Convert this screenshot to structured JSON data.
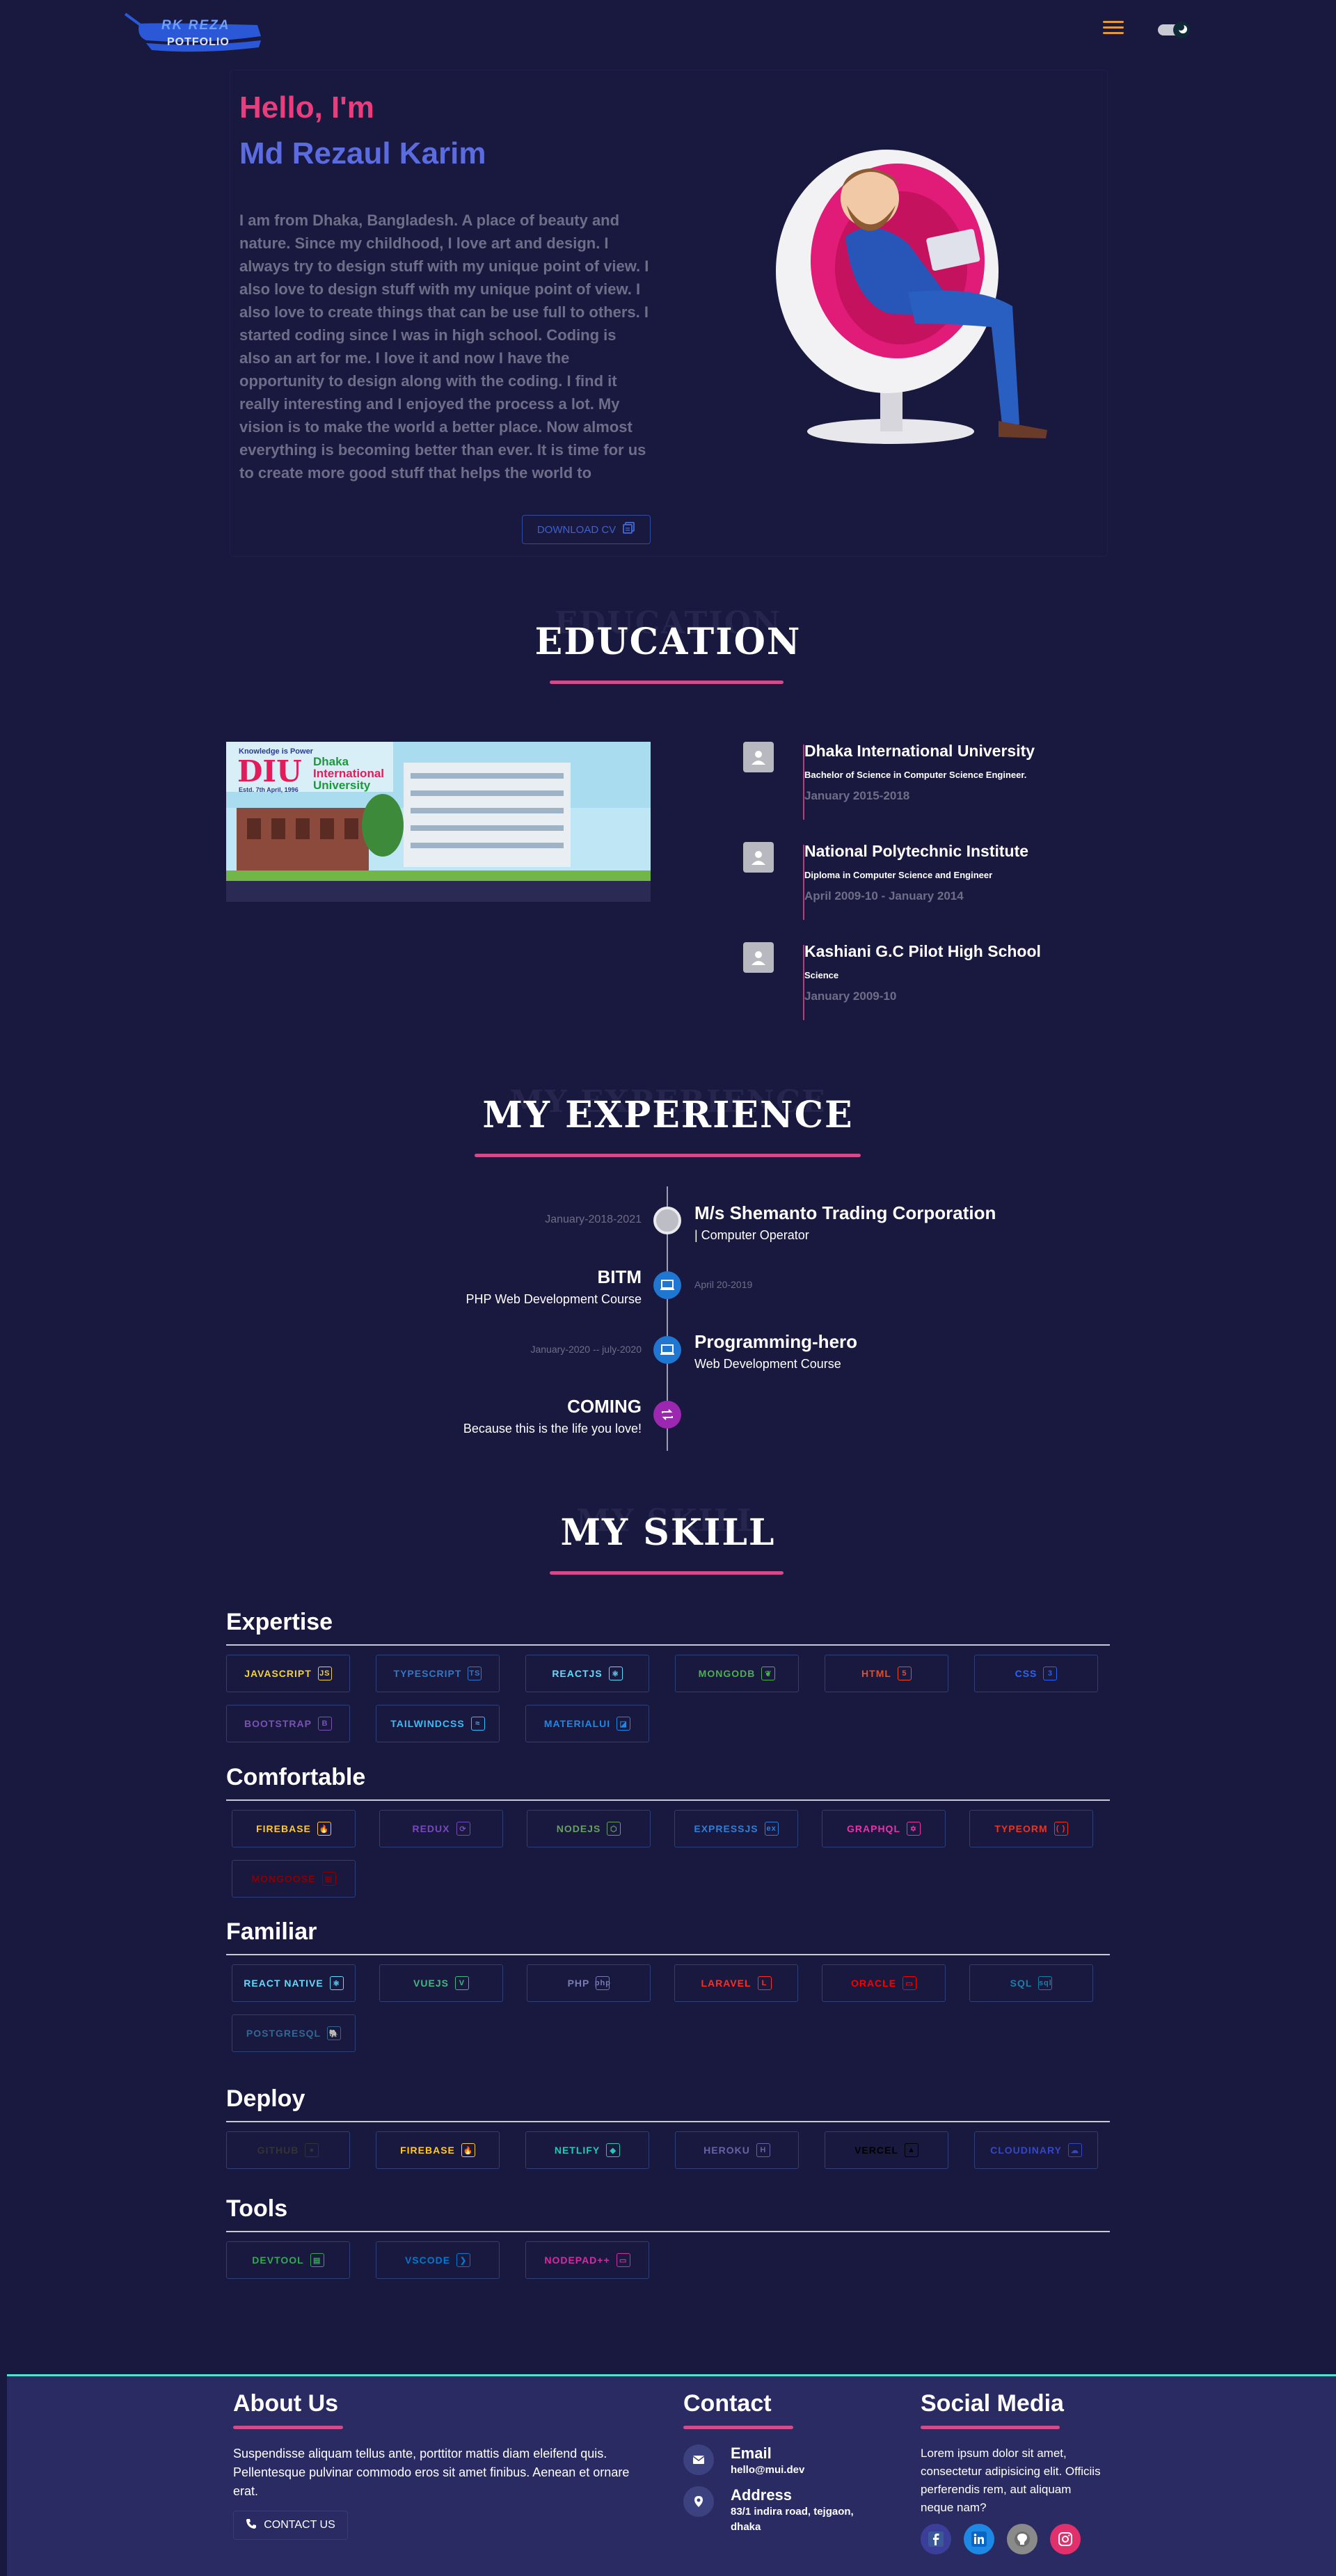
{
  "header": {
    "logo_line1": "RK REZA",
    "logo_line2": "POTFOLIO",
    "menu_icon": "hamburger-icon",
    "theme_toggle_icon": "theme-toggle-icon"
  },
  "hero": {
    "greeting": "Hello, I'm",
    "name": "Md Rezaul Karim",
    "bio": "I am from Dhaka, Bangladesh. A place of beauty and nature. Since my childhood, I love art and design. I always try to design stuff with my unique point of view. I also love to design stuff with my unique point of view. I also love to create things that can be use full to others. I started coding since I was in high school. Coding is also an art for me. I love it and now I have the opportunity to design along with the coding. I find it really interesting and I enjoyed the process a lot. My vision is to make the world a better place. Now almost everything is becoming better than ever. It is time for us to create more good stuff that helps the world to become a better place.",
    "download_label": "DOWNLOAD CV",
    "colors": {
      "greeting": "#ea3d7c",
      "name": "#5b6be0"
    }
  },
  "education": {
    "ghost": "EDUCATION",
    "title": "EDUCATION",
    "image": {
      "tagline": "Knowledge is Power",
      "abbr": "DIU",
      "est": "Estd. 7th April, 1996",
      "name_line1": "Dhaka",
      "name_line2": "International",
      "name_line3": "University"
    },
    "items": [
      {
        "name": "Dhaka International University",
        "degree": "Bachelor of Science in Computer Science Engineer.",
        "date": "January 2015-2018"
      },
      {
        "name": "National Polytechnic Institute",
        "degree": "Diploma in Computer Science and Engineer",
        "date": "April 2009-10 - January 2014"
      },
      {
        "name": "Kashiani G.C Pilot High School",
        "degree": "Science",
        "date": "January 2009-10"
      }
    ]
  },
  "experience": {
    "ghost": "MY EXPERIENCE",
    "title": "MY EXPERIENCE",
    "items": [
      {
        "side": "right",
        "title": "M/s Shemanto Trading Corporation",
        "subtitle": "| Computer Operator",
        "date": "January-2018-2021"
      },
      {
        "side": "left",
        "title": "BITM",
        "subtitle": "PHP Web Development Course",
        "date": "April 20-2019"
      },
      {
        "side": "right",
        "title": "Programming-hero",
        "subtitle": "Web Development Course",
        "date": "January-2020 -- july-2020"
      },
      {
        "side": "left",
        "title": "COMING",
        "subtitle": "Because this is the life you love!",
        "date": ""
      }
    ]
  },
  "skills": {
    "ghost": "MY SKILL",
    "title": "MY SKILL",
    "groups": [
      {
        "title": "Expertise",
        "items": [
          {
            "label": "JAVASCRIPT",
            "color": "#f0d33a",
            "icon": "JS"
          },
          {
            "label": "TYPESCRIPT",
            "color": "#3178c6",
            "icon": "TS"
          },
          {
            "label": "REACTJS",
            "color": "#61dafb",
            "icon": "⚛"
          },
          {
            "label": "MONGODB",
            "color": "#4caf50",
            "icon": "❦"
          },
          {
            "label": "HTML",
            "color": "#e44d26",
            "icon": "5"
          },
          {
            "label": "CSS",
            "color": "#2965f1",
            "icon": "3"
          },
          {
            "label": "BOOTSTRAP",
            "color": "#7952b3",
            "icon": "B"
          },
          {
            "label": "TAILWINDCSS",
            "color": "#38bdf8",
            "icon": "≈"
          },
          {
            "label": "MATERIALUI",
            "color": "#1e88e5",
            "icon": "◪"
          }
        ]
      },
      {
        "title": "Comfortable",
        "items": [
          {
            "label": "FIREBASE",
            "color": "#ffca28",
            "icon": "🔥"
          },
          {
            "label": "REDUX",
            "color": "#764abc",
            "icon": "⟳"
          },
          {
            "label": "NODEJS",
            "color": "#68a063",
            "icon": "⬡"
          },
          {
            "label": "EXPRESSJS",
            "color": "#2f7fd6",
            "icon": "ex"
          },
          {
            "label": "GRAPHQL",
            "color": "#e535ab",
            "icon": "✡"
          },
          {
            "label": "TYPEORM",
            "color": "#e83524",
            "icon": "( )"
          },
          {
            "label": "MONGOOSE",
            "color": "#880000",
            "icon": "▤"
          }
        ]
      },
      {
        "title": "Familiar",
        "items": [
          {
            "label": "REACT NATIVE",
            "color": "#61dafb",
            "icon": "⚛"
          },
          {
            "label": "VUEJS",
            "color": "#41b883",
            "icon": "V"
          },
          {
            "label": "PHP",
            "color": "#777bb4",
            "icon": "php"
          },
          {
            "label": "LARAVEL",
            "color": "#ff2d20",
            "icon": "L"
          },
          {
            "label": "ORACLE",
            "color": "#f80000",
            "icon": "▭"
          },
          {
            "label": "SQL",
            "color": "#1a7fa8",
            "icon": "sql"
          },
          {
            "label": "POSTGRESQL",
            "color": "#336791",
            "icon": "🐘"
          }
        ]
      },
      {
        "title": "Deploy",
        "items": [
          {
            "label": "GITHUB",
            "color": "#333333",
            "icon": "●"
          },
          {
            "label": "FIREBASE",
            "color": "#ffca28",
            "icon": "🔥"
          },
          {
            "label": "NETLIFY",
            "color": "#25c7b7",
            "icon": "◆"
          },
          {
            "label": "HEROKU",
            "color": "#6762a6",
            "icon": "H"
          },
          {
            "label": "VERCEL",
            "color": "#000000",
            "icon": "▲"
          },
          {
            "label": "CLOUDINARY",
            "color": "#3448c5",
            "icon": "☁"
          }
        ]
      },
      {
        "title": "Tools",
        "items": [
          {
            "label": "DEVTOOL",
            "color": "#34a853",
            "icon": "▤"
          },
          {
            "label": "VSCODE",
            "color": "#007acc",
            "icon": "❯"
          },
          {
            "label": "NODEPAD++",
            "color": "#d02fa0",
            "icon": "▭"
          }
        ]
      }
    ]
  },
  "footer": {
    "about_title": "About Us",
    "about_text": "Suspendisse aliquam tellus ante, porttitor mattis diam eleifend quis. Pellentesque pulvinar commodo eros sit amet finibus. Aenean et ornare erat.",
    "contact_button": "CONTACT US",
    "contact_title": "Contact",
    "email_label": "Email",
    "email_value": "hello@mui.dev",
    "address_label": "Address",
    "address_value": "83/1 indira road, tejgaon, dhaka",
    "social_title": "Social Media",
    "social_text": "Lorem ipsum dolor sit amet, consectetur adipisicing elit. Officiis perferendis rem, aut aliquam neque nam?",
    "social_icons": [
      {
        "name": "facebook-icon",
        "color": "#3b5998"
      },
      {
        "name": "linkedin-icon",
        "color": "#0a66c2"
      },
      {
        "name": "github-icon",
        "color": "#6e6e6e"
      },
      {
        "name": "instagram-icon",
        "color": "#e1306c"
      }
    ]
  }
}
